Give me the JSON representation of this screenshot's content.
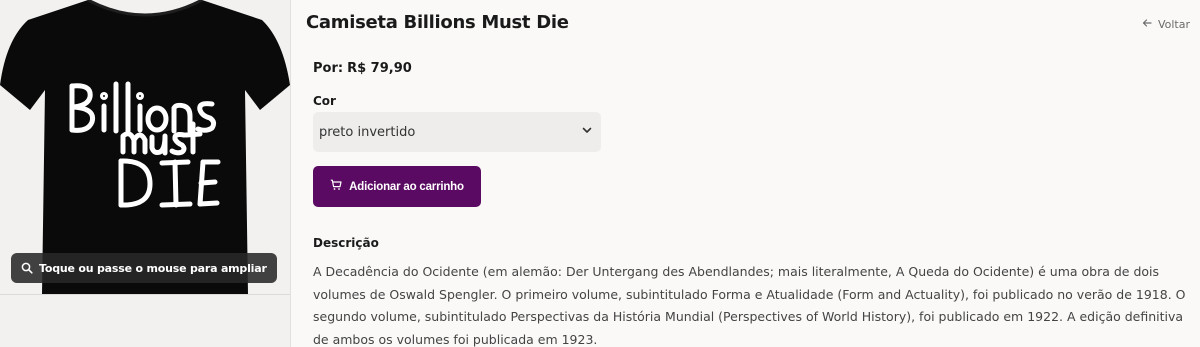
{
  "product": {
    "title": "Camiseta Billions Must Die",
    "price_label": "Por:",
    "price_value": "R$ 79,90",
    "shirt_print": [
      "Billions",
      "must",
      "DIE"
    ],
    "zoom_hint": "Toque ou passe o mouse para ampliar"
  },
  "navigation": {
    "back_label": "Voltar"
  },
  "options": {
    "color_label": "Cor",
    "color_selected": "preto invertido"
  },
  "actions": {
    "add_to_cart_label": "Adicionar ao carrinho"
  },
  "description": {
    "heading": "Descrição",
    "text": "A Decadência do Ocidente (em alemão: Der Untergang des Abendlandes; mais literalmente, A Queda do Ocidente) é uma obra de dois volumes de Oswald Spengler. O primeiro volume, subintitulado Forma e Atualidade (Form and Actuality), foi publicado no verão de 1918. O segundo volume, subintitulado Perspectivas da História Mundial (Perspectives of World History), foi publicado em 1922. A edição definitiva de ambos os volumes foi publicada em 1923."
  },
  "colors": {
    "accent": "#5b0a63",
    "page_background": "#faf9f8",
    "select_background": "#eeedec",
    "shirt": "#0a0a0a",
    "shirt_print": "#ffffff"
  },
  "icons": {
    "zoom": "magnifier-icon",
    "back": "arrow-left-icon",
    "select": "chevron-down-icon",
    "cart": "cart-icon"
  }
}
